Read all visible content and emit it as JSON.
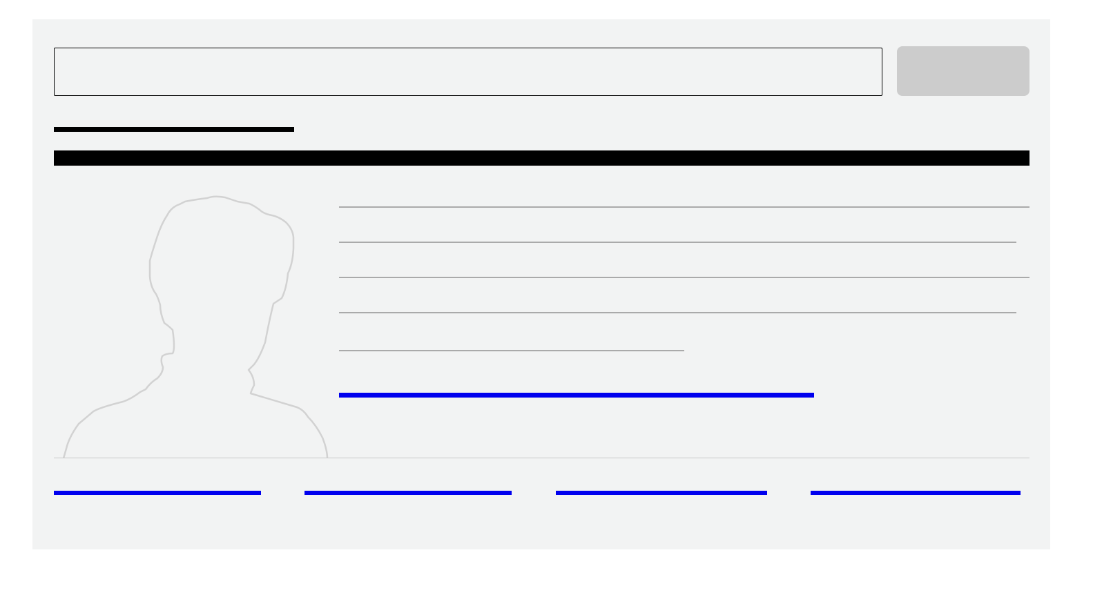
{
  "search": {
    "value": "",
    "placeholder": ""
  },
  "submit_button": {
    "label": ""
  },
  "profile": {
    "avatar_icon": "person-silhouette-icon"
  },
  "colors": {
    "background": "#f2f3f3",
    "link": "#0000ee",
    "placeholder_text": "#aaaaaa",
    "button": "#cccccc"
  },
  "footer_links": [
    {
      "label": ""
    },
    {
      "label": ""
    },
    {
      "label": ""
    },
    {
      "label": ""
    }
  ]
}
